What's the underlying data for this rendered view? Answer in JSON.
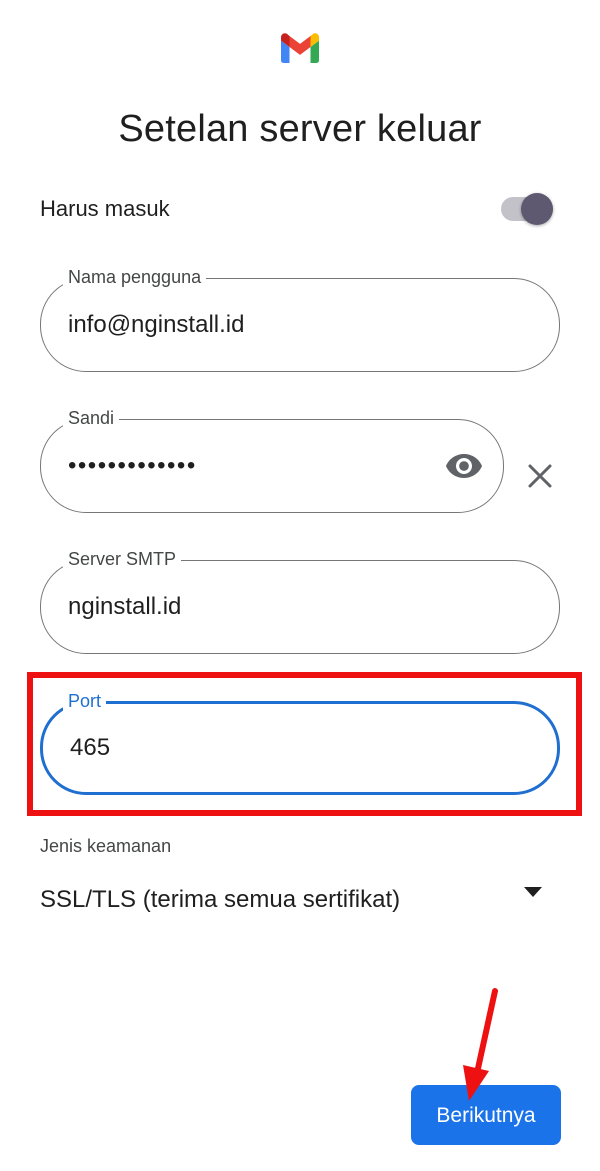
{
  "header": {
    "title": "Setelan server keluar",
    "logo_icon": "gmail-logo-icon"
  },
  "require_signin": {
    "label": "Harus masuk",
    "enabled": true
  },
  "username": {
    "label": "Nama pengguna",
    "value": "info@nginstall.id"
  },
  "password": {
    "label": "Sandi",
    "value": "•••••••••••••",
    "visibility_icon": "eye-icon",
    "clear_icon": "close-icon"
  },
  "smtp_server": {
    "label": "Server SMTP",
    "value": "nginstall.id"
  },
  "port": {
    "label": "Port",
    "value": "465",
    "focused": true
  },
  "security": {
    "label": "Jenis keamanan",
    "value": "SSL/TLS (terima semua sertifikat)",
    "dropdown_icon": "caret-down-icon"
  },
  "actions": {
    "next_label": "Berikutnya"
  },
  "annotations": {
    "highlight_color": "#ee1111",
    "arrow_color": "#ee1111"
  },
  "colors": {
    "accent": "#1a73e8",
    "focus": "#1f6fd0",
    "toggle_knob": "#5e5870",
    "toggle_track": "#c4c2c9"
  }
}
